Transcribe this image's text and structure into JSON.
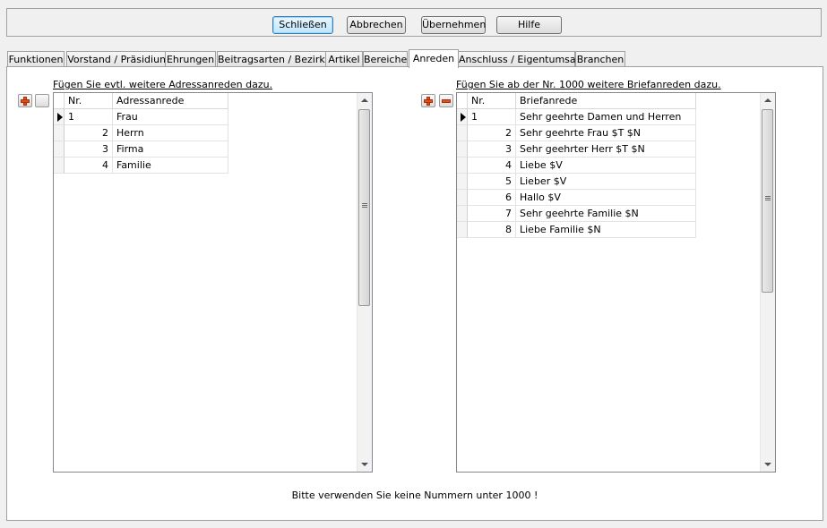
{
  "toolbar": {
    "close_label": "Schließen",
    "cancel_label": "Abbrechen",
    "apply_label": "Übernehmen",
    "help_label": "Hilfe"
  },
  "tabs": [
    {
      "label": "Funktionen"
    },
    {
      "label": "Vorstand / Präsidium"
    },
    {
      "label": "Ehrungen"
    },
    {
      "label": "Beitragsarten / Bezirke"
    },
    {
      "label": "Artikel"
    },
    {
      "label": "Bereiche"
    },
    {
      "label": "Anreden",
      "active": true
    },
    {
      "label": "Anschluss / Eigentumsart"
    },
    {
      "label": "Branchen"
    }
  ],
  "left": {
    "hint": "Fügen Sie evtl. weitere Adressanreden dazu.",
    "col_nr": "Nr.",
    "col_text": "Adressanrede",
    "rows": [
      {
        "nr": "1",
        "text": "Frau"
      },
      {
        "nr": "2",
        "text": "Herrn"
      },
      {
        "nr": "3",
        "text": "Firma"
      },
      {
        "nr": "4",
        "text": "Familie"
      }
    ]
  },
  "right": {
    "hint": "Fügen Sie ab der Nr. 1000 weitere Briefanreden dazu.",
    "col_nr": "Nr.",
    "col_text": "Briefanrede",
    "rows": [
      {
        "nr": "1",
        "text": "Sehr geehrte Damen und Herren"
      },
      {
        "nr": "2",
        "text": "Sehr geehrte Frau $T $N"
      },
      {
        "nr": "3",
        "text": "Sehr geehrter Herr $T $N"
      },
      {
        "nr": "4",
        "text": "Liebe $V"
      },
      {
        "nr": "5",
        "text": "Lieber $V"
      },
      {
        "nr": "6",
        "text": "Hallo $V"
      },
      {
        "nr": "7",
        "text": "Sehr geehrte Familie $N"
      },
      {
        "nr": "8",
        "text": "Liebe Familie $N"
      }
    ]
  },
  "footer_note": "Bitte verwenden Sie keine Nummern unter 1000 !",
  "icons": {
    "add": "plus-icon",
    "remove": "minus-icon",
    "current_row": "row-indicator-icon",
    "scroll_up": "scroll-up-arrow-icon",
    "scroll_down": "scroll-down-arrow-icon"
  },
  "colors": {
    "icon_accent": "#e0501a",
    "default_button": "#bee6fd"
  }
}
